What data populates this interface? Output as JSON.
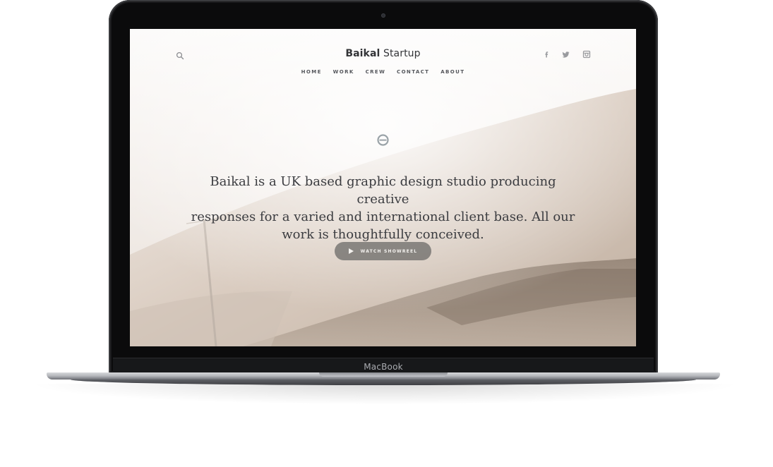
{
  "device": {
    "brand_label": "MacBook"
  },
  "site": {
    "logo_bold": "Baikal",
    "logo_regular": "Startup",
    "nav": [
      "HOME",
      "WORK",
      "CREW",
      "CONTACT",
      "ABOUT"
    ],
    "social_icons": [
      "facebook-icon",
      "twitter-icon",
      "instagram-icon"
    ],
    "headline_lines": [
      "Baikal is a UK based graphic design studio producing creative",
      "responses for a varied and international client base. All our",
      "work is thoughtfully conceived."
    ],
    "cta_label": "WATCH SHOWREEL"
  },
  "colors": {
    "lid": "#0b0b0c",
    "screen_bg": "#fbfaf9",
    "text_dark": "#333437",
    "cta_bg": "#706e6c"
  }
}
